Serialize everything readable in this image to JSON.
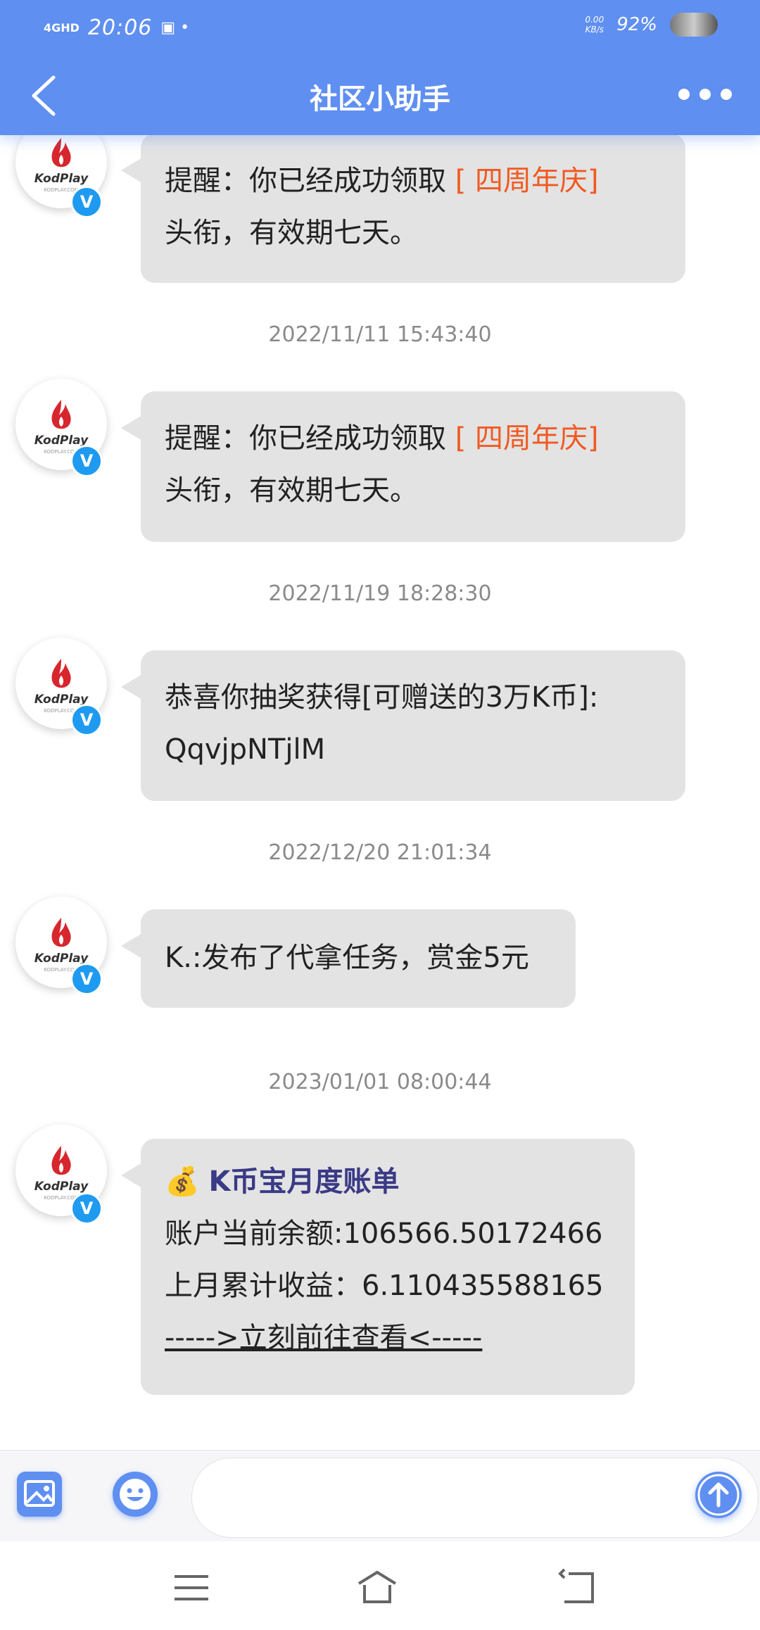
{
  "status_bar": {
    "network": "4GHD",
    "time": "20:06",
    "speed_value": "0.00",
    "speed_unit": "KB/s",
    "battery": "92%"
  },
  "header": {
    "title": "社区小助手"
  },
  "avatar": {
    "brand": "KodPlay",
    "sub": "KODPLAY.COM",
    "verified_glyph": "V"
  },
  "messages": [
    {
      "line1_prefix": "提醒：你已经成功领取 ",
      "line1_highlight": "[ 四周年庆]",
      "line2": "头衔，有效期七天。"
    },
    {
      "timestamp": "2022/11/11 15:43:40",
      "line1_prefix": "提醒：你已经成功领取 ",
      "line1_highlight": "[ 四周年庆]",
      "line2": "头衔，有效期七天。"
    },
    {
      "timestamp": "2022/11/19 18:28:30",
      "line1": "恭喜你抽奖获得[可赠送的3万K币]:",
      "line2": "QqvjpNTjlM"
    },
    {
      "timestamp": "2022/12/20 21:01:34",
      "line1": "K.:发布了代拿任务，赏金5元"
    },
    {
      "timestamp": "2023/01/01 08:00:44",
      "title_icon": "💰",
      "title": "K币宝月度账单",
      "balance": "账户当前余额:106566.50172466",
      "income": "上月累计收益：6.110435588165",
      "link": "----->立刻前往查看<-----"
    }
  ],
  "input": {
    "placeholder": ""
  },
  "colors": {
    "accent": "#5f8ff0",
    "highlight": "#f05a22",
    "bubble": "#e3e3e3",
    "verified": "#1e9bf0"
  }
}
